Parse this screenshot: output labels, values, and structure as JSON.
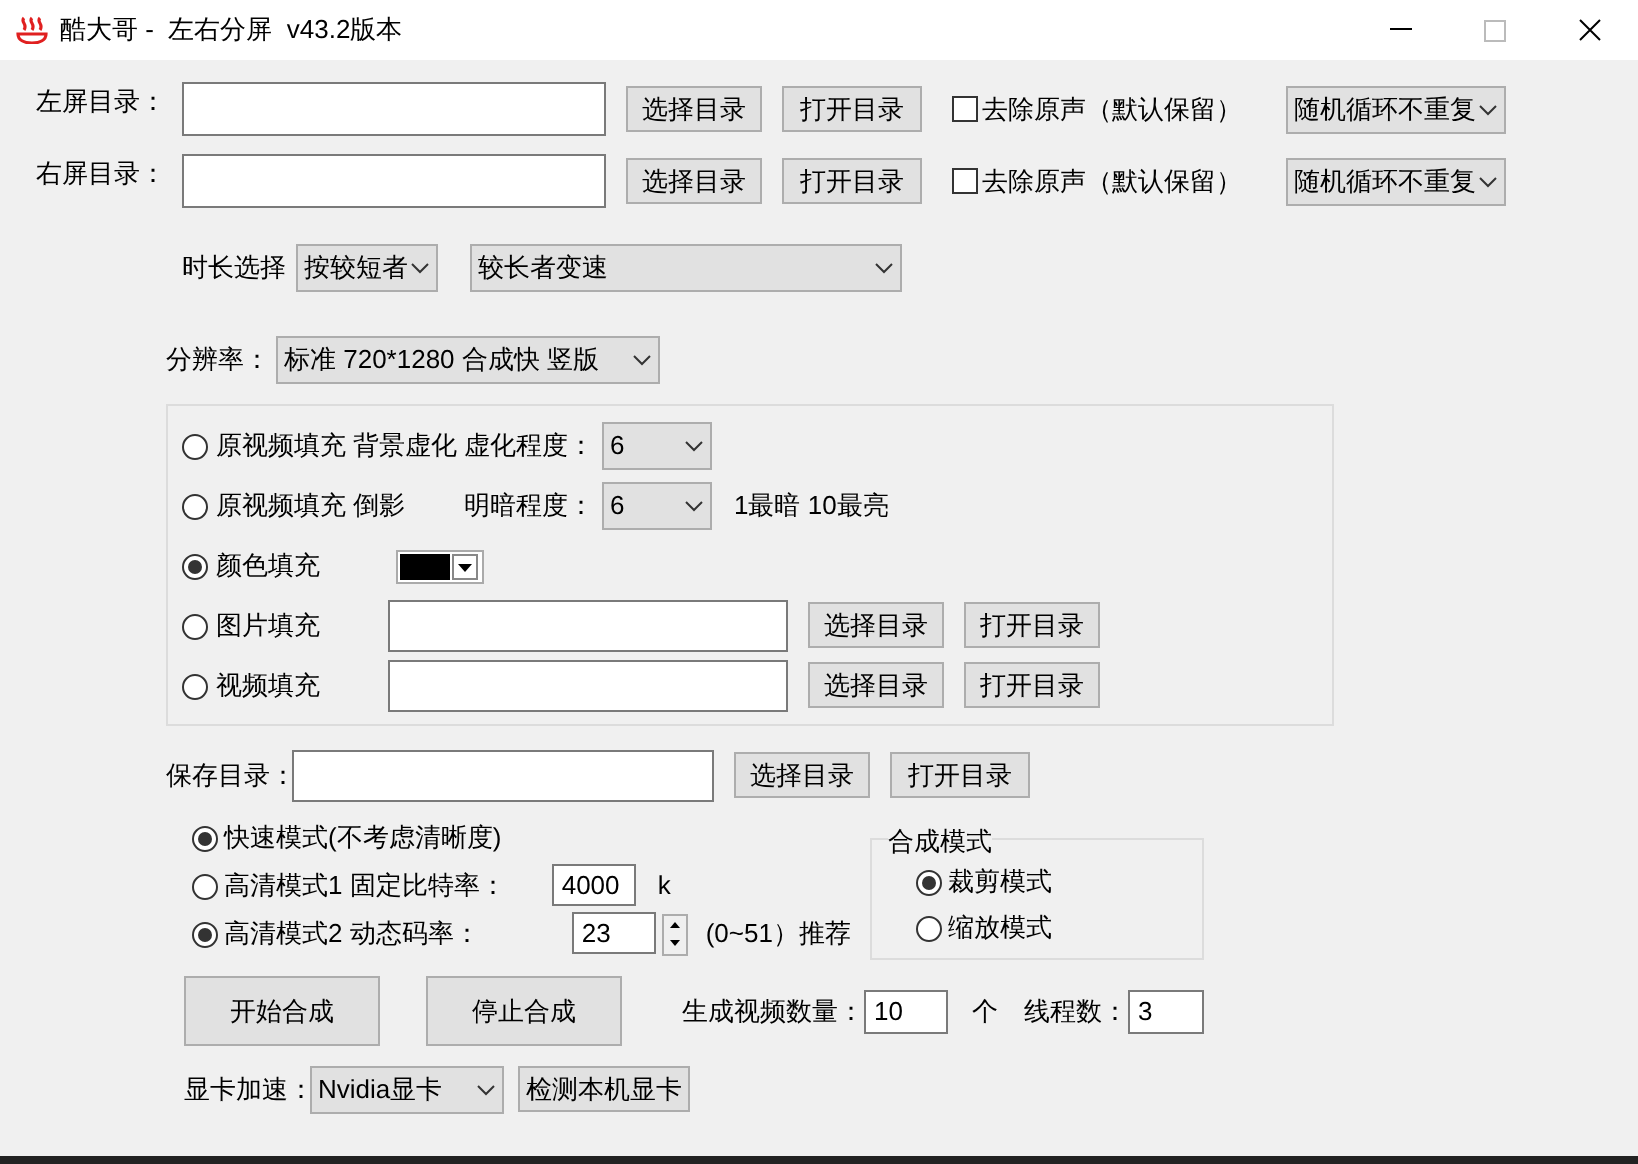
{
  "window": {
    "title": "酷大哥 -  左右分屏  v43.2版本"
  },
  "dirs": [
    {
      "label": "左屏目录：",
      "select_button": "选择目录",
      "open_button": "打开目录",
      "mute": {
        "label": "去除原声（默认保留）",
        "checked": false
      },
      "order": "随机循环不重复"
    },
    {
      "label": "右屏目录：",
      "select_button": "选择目录",
      "open_button": "打开目录",
      "mute": {
        "label": "去除原声（默认保留）",
        "checked": false
      },
      "order": "随机循环不重复"
    }
  ],
  "duration": {
    "label": "时长选择",
    "mode": "按较短者",
    "action": "较长者变速"
  },
  "resolution": {
    "label": "分辨率：",
    "value": "标准 720*1280 合成快 竖版"
  },
  "fill_options": [
    {
      "kind": "level",
      "label": "原视频填充 背景虚化",
      "selected": false,
      "setting_label": "虚化程度：",
      "setting_value": "6"
    },
    {
      "kind": "level",
      "label": "原视频填充 倒影",
      "selected": false,
      "setting_label": "明暗程度：",
      "setting_value": "6",
      "note": "1最暗 10最亮"
    },
    {
      "kind": "color",
      "label": "颜色填充",
      "selected": true,
      "color": "#000000"
    },
    {
      "kind": "path",
      "label": "图片填充",
      "selected": false,
      "select_button": "选择目录",
      "open_button": "打开目录"
    },
    {
      "kind": "path",
      "label": "视频填充",
      "selected": false,
      "select_button": "选择目录",
      "open_button": "打开目录"
    }
  ],
  "save": {
    "label": "保存目录：",
    "select_button": "选择目录",
    "open_button": "打开目录"
  },
  "quality_modes": [
    {
      "kind": "plain",
      "label": "快速模式(不考虑清晰度)",
      "selected": true
    },
    {
      "kind": "bitrate",
      "label": "高清模式1 固定比特率：",
      "selected": false,
      "value": "4000",
      "unit": "k"
    },
    {
      "kind": "crf",
      "label": "高清模式2 动态码率：",
      "selected": true,
      "value": "23",
      "note": "(0~51）推荐"
    }
  ],
  "compose_mode": {
    "title": "合成模式",
    "options": [
      {
        "label": "裁剪模式",
        "selected": true
      },
      {
        "label": "缩放模式",
        "selected": false
      }
    ]
  },
  "actions": [
    "开始合成",
    "停止合成"
  ],
  "count": {
    "label": "生成视频数量：",
    "value": "10",
    "unit": "个"
  },
  "threads": {
    "label": "线程数：",
    "value": "3"
  },
  "gpu": {
    "label": "显卡加速：",
    "value": "Nvidia显卡",
    "detect_button": "检测本机显卡"
  }
}
